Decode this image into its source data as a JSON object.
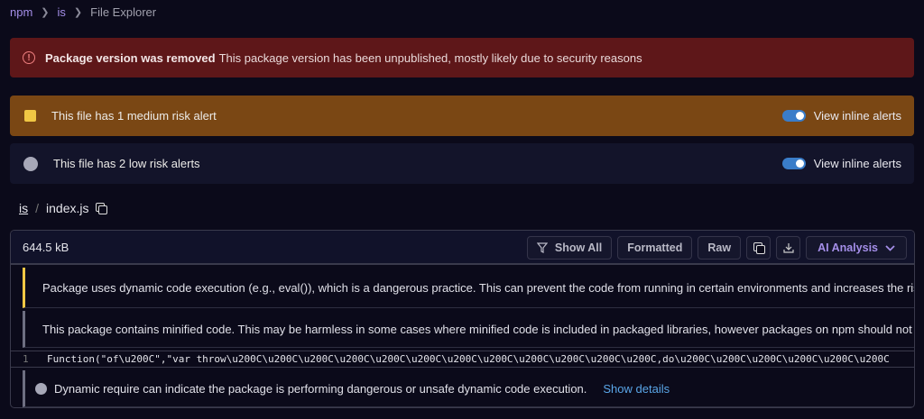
{
  "breadcrumb": {
    "items": [
      "npm",
      "is"
    ],
    "current": "File Explorer"
  },
  "removed_banner": {
    "title": "Package version was removed",
    "message": "This package version has been unpublished, mostly likely due to security reasons"
  },
  "medium_alert": {
    "text": "This file has 1 medium risk alert",
    "toggle_label": "View inline alerts",
    "toggle_on": true
  },
  "low_alert": {
    "text": "This file has 2 low risk alerts",
    "toggle_label": "View inline alerts",
    "toggle_on": true
  },
  "file_path": {
    "dir": "is",
    "file": "index.js"
  },
  "file": {
    "size": "644.5 kB",
    "toolbar": {
      "show_all": "Show All",
      "formatted": "Formatted",
      "raw": "Raw",
      "ai_analysis": "AI Analysis"
    }
  },
  "alerts": [
    {
      "severity": "medium",
      "text": "Package uses dynamic code execution (e.g., eval()), which is a dangerous practice. This can prevent the code from running in certain environments and increases the risk that"
    },
    {
      "severity": "low",
      "text": "This package contains minified code. This may be harmless in some cases where minified code is included in packaged libraries, however packages on npm should not minify"
    },
    {
      "severity": "low",
      "text": "Dynamic require can indicate the package is performing dangerous or unsafe dynamic code execution.",
      "link": "Show details"
    }
  ],
  "code": {
    "line_number": "1",
    "text": "Function(\"of\\u200C\",\"var throw\\u200C\\u200C\\u200C\\u200C\\u200C\\u200C\\u200C\\u200C\\u200C\\u200C\\u200C\\u200C,do\\u200C\\u200C\\u200C\\u200C\\u200C\\u200C"
  },
  "colors": {
    "accent": "#a48ee8",
    "link": "#5aa6e8",
    "danger": "#5e1719",
    "medium": "#7a4714",
    "toggle": "#3a7dc9"
  }
}
